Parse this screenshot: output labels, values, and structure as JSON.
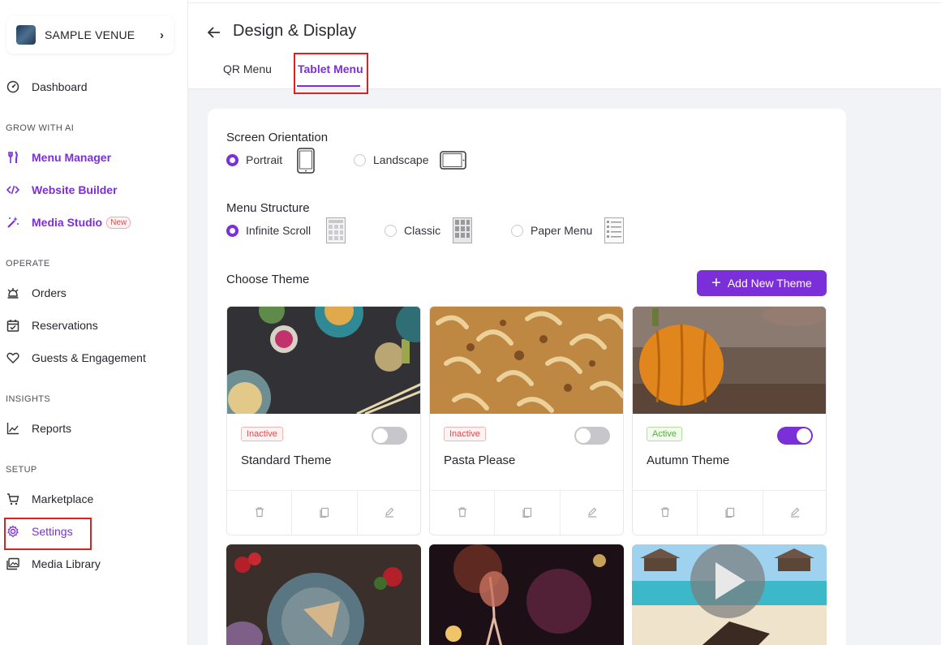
{
  "venue": {
    "name": "SAMPLE VENUE"
  },
  "sidebar": {
    "dashboard": "Dashboard",
    "sections": {
      "grow": "GROW WITH AI",
      "operate": "OPERATE",
      "insights": "INSIGHTS",
      "setup": "SETUP"
    },
    "menu_manager": "Menu Manager",
    "website_builder": "Website Builder",
    "media_studio": "Media Studio",
    "new_badge": "New",
    "orders": "Orders",
    "reservations": "Reservations",
    "guests": "Guests & Engagement",
    "reports": "Reports",
    "marketplace": "Marketplace",
    "settings": "Settings",
    "media_library": "Media Library"
  },
  "header": {
    "title": "Design & Display",
    "tabs": [
      "QR Menu",
      "Tablet Menu"
    ]
  },
  "orientation": {
    "heading": "Screen Orientation",
    "options": [
      "Portrait",
      "Landscape"
    ],
    "selected": "Portrait"
  },
  "structure": {
    "heading": "Menu Structure",
    "options": [
      "Infinite Scroll",
      "Classic",
      "Paper Menu"
    ],
    "selected": "Infinite Scroll"
  },
  "themes_section": {
    "heading": "Choose Theme",
    "add_label": "Add New Theme"
  },
  "themes": [
    {
      "name": "Standard Theme",
      "status": "Inactive",
      "enabled": false
    },
    {
      "name": "Pasta Please",
      "status": "Inactive",
      "enabled": false
    },
    {
      "name": "Autumn Theme",
      "status": "Active",
      "enabled": true
    }
  ],
  "colors": {
    "accent": "#7b2fd8",
    "highlight": "#e01f1f"
  }
}
